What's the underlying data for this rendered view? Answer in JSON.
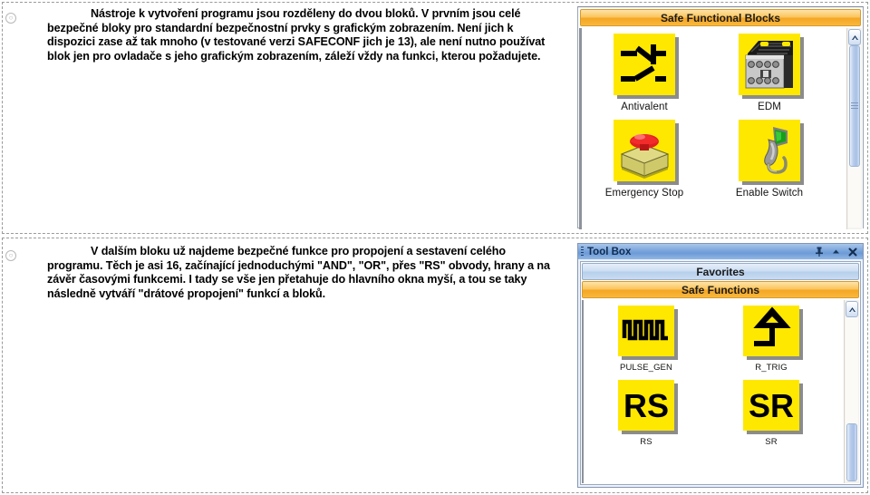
{
  "slide": {
    "paragraph_marker": "○",
    "top_text": "Nástroje k vytvoření programu jsou rozděleny do dvou bloků. V prvním jsou celé bezpečné bloky pro standardní bezpečnostní prvky s grafickým zobrazením. Není jich k dispozici zase až tak mnoho (v testované verzi SAFECONF jich je 13), ale není nutno používat blok jen pro ovladače s jeho grafickým zobrazením, záleží vždy na funkci, kterou požadujete.",
    "bottom_text": "V dalším bloku už najdeme bezpečné funkce pro propojení a sestavení celého programu. Těch je asi 16, začínající jednoduchými \"AND\", \"OR\", přes \"RS\" obvody, hrany a na závěr časovými funkcemi. I tady se vše jen přetahuje do hlavního okna myší, a tou se taky následně vytváří \"drátové propojení\" funkcí a bloků."
  },
  "safe_blocks_panel": {
    "header": "Safe Functional Blocks",
    "items": [
      {
        "label": "Antivalent",
        "icon": "antivalent-contacts-icon"
      },
      {
        "label": "EDM",
        "icon": "contactor-icon"
      },
      {
        "label": "Emergency Stop",
        "icon": "emergency-stop-button-icon"
      },
      {
        "label": "Enable Switch",
        "icon": "enable-switch-grip-icon"
      }
    ],
    "scrollbar": {
      "up_arrow": "scroll-up-icon",
      "thumb_grip": "scrollbar-grip-icon"
    }
  },
  "toolbox_panel": {
    "title": "Tool Box",
    "title_icons": [
      {
        "name": "auto-hide-pin-icon",
        "glyph": "pin"
      },
      {
        "name": "collapse-chevron-icon",
        "glyph": "chevron-up"
      },
      {
        "name": "close-icon",
        "glyph": "x"
      }
    ],
    "sections": [
      {
        "label": "Favorites",
        "style": "blue"
      },
      {
        "label": "Safe Functions",
        "style": "orange"
      }
    ],
    "items": [
      {
        "label": "PULSE_GEN",
        "icon": "pulse-waveform-icon"
      },
      {
        "label": "R_TRIG",
        "icon": "rising-edge-icon"
      },
      {
        "label": "RS",
        "icon": "rs-flipflop-icon",
        "glyph": "RS"
      },
      {
        "label": "SR",
        "icon": "sr-flipflop-icon",
        "glyph": "SR"
      }
    ],
    "scrollbar": {
      "up_arrow": "scroll-up-icon"
    }
  },
  "colors": {
    "icon_tile_yellow": "#ffe800",
    "orange_header": "#f5a623",
    "blue_header": "#b6d0ec",
    "titlebar_blue": "#6d9bd6"
  }
}
